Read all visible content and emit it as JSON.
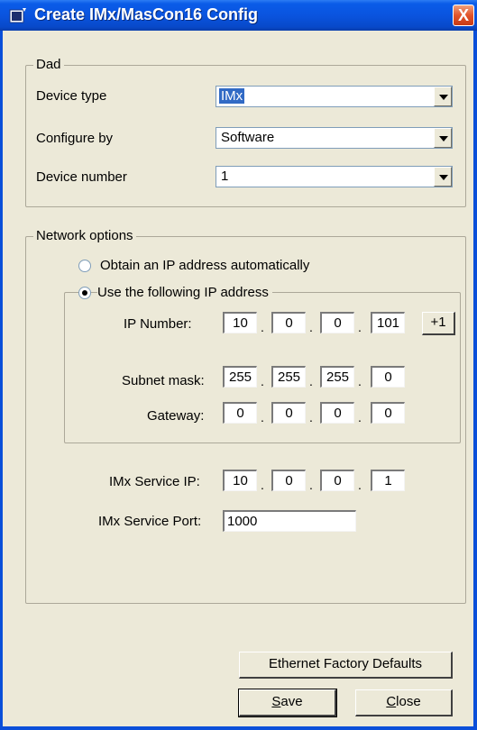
{
  "window": {
    "title": "Create IMx/MasCon16 Config",
    "close_label": "X"
  },
  "dad": {
    "legend": "Dad",
    "device_type": {
      "label": "Device type",
      "value": "IMx"
    },
    "configure_by": {
      "label": "Configure by",
      "value": "Software"
    },
    "device_number": {
      "label": "Device number",
      "value": "1"
    }
  },
  "network": {
    "legend": "Network options",
    "auto_ip_label": "Obtain an IP address automatically",
    "manual_ip_label": "Use the following IP address",
    "ip_number": {
      "label": "IP Number:",
      "octets": [
        "10",
        "0",
        "0",
        "101"
      ],
      "increment_label": "+1"
    },
    "subnet_mask": {
      "label": "Subnet mask:",
      "octets": [
        "255",
        "255",
        "255",
        "0"
      ]
    },
    "gateway": {
      "label": "Gateway:",
      "octets": [
        "0",
        "0",
        "0",
        "0"
      ]
    },
    "service_ip": {
      "label": "IMx Service IP:",
      "octets": [
        "10",
        "0",
        "0",
        "1"
      ]
    },
    "service_port": {
      "label": "IMx Service Port:",
      "value": "1000"
    },
    "selected_mode": "manual"
  },
  "buttons": {
    "factory_defaults": "Ethernet Factory Defaults",
    "save_first": "S",
    "save_rest": "ave",
    "close_first": "C",
    "close_rest": "lose"
  }
}
